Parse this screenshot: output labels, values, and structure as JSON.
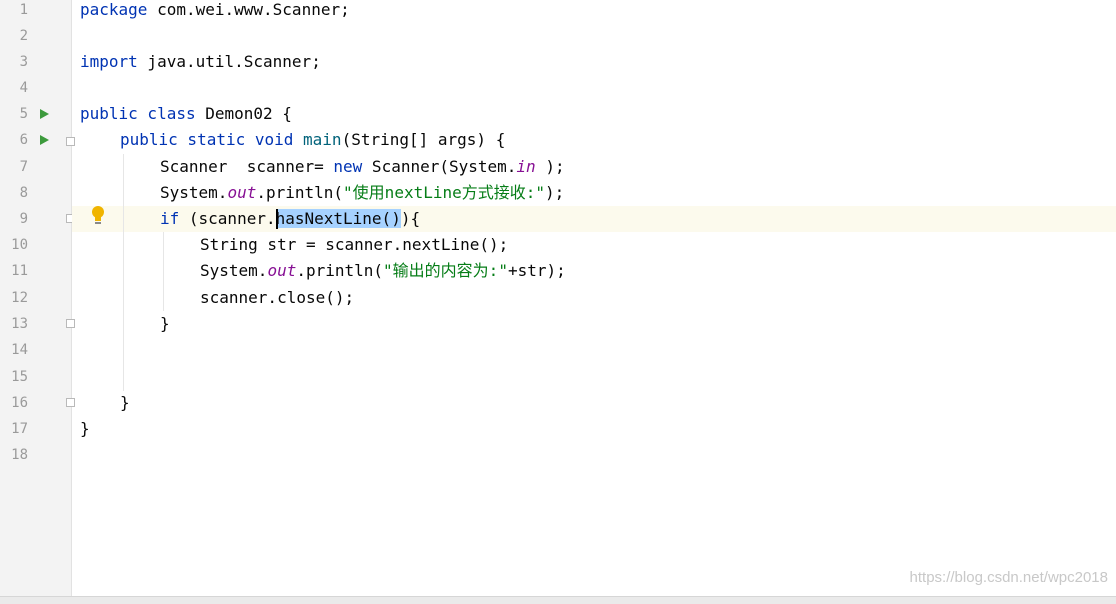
{
  "editor": {
    "line_numbers": [
      "1",
      "2",
      "3",
      "4",
      "5",
      "6",
      "7",
      "8",
      "9",
      "10",
      "11",
      "12",
      "13",
      "14",
      "15",
      "16",
      "17",
      "18"
    ],
    "lines": {
      "l1": {
        "kw": "package",
        "rest": " com.wei.www.Scanner;"
      },
      "l3": {
        "kw": "import",
        "rest": " java.util.Scanner;"
      },
      "l5": {
        "kw": "public class",
        "rest": " Demon02 {"
      },
      "l6": {
        "kw": "public static void",
        "name": "main",
        "rest": "(String[] args) {"
      },
      "l7": {
        "a": "Scanner  scanner= ",
        "kw": "new",
        "b": " Scanner(System.",
        "field": "in",
        "c": " );"
      },
      "l8": {
        "a": "System.",
        "field": "out",
        "b": ".println(",
        "str": "\"使用nextLine方式接收:\"",
        "c": ");"
      },
      "l9": {
        "kw": "if",
        "a": " (scanner.",
        "selected": "hasNextLine()",
        "b": "){"
      },
      "l10": {
        "text": "String str = scanner.nextLine();"
      },
      "l11": {
        "a": "System.",
        "field": "out",
        "b": ".println(",
        "str": "\"输出的内容为:\"",
        "c": "+str);"
      },
      "l12": {
        "text": "scanner.close();"
      },
      "l13": {
        "text": "}"
      },
      "l16": {
        "text": "}"
      },
      "l17": {
        "text": "}"
      }
    },
    "icons": {
      "run": "run-triangle-icon",
      "fold": "fold-marker-icon",
      "intention": "lightbulb-icon"
    },
    "colors": {
      "keyword": "#0033b3",
      "string": "#067d17",
      "static_field": "#871094",
      "selection": "#a6d2ff",
      "current_line": "#fcfaed",
      "gutter": "#f3f3f3",
      "run_icon": "#3c9a3c",
      "bulb": "#f0b400"
    }
  },
  "watermark": "https://blog.csdn.net/wpc2018"
}
